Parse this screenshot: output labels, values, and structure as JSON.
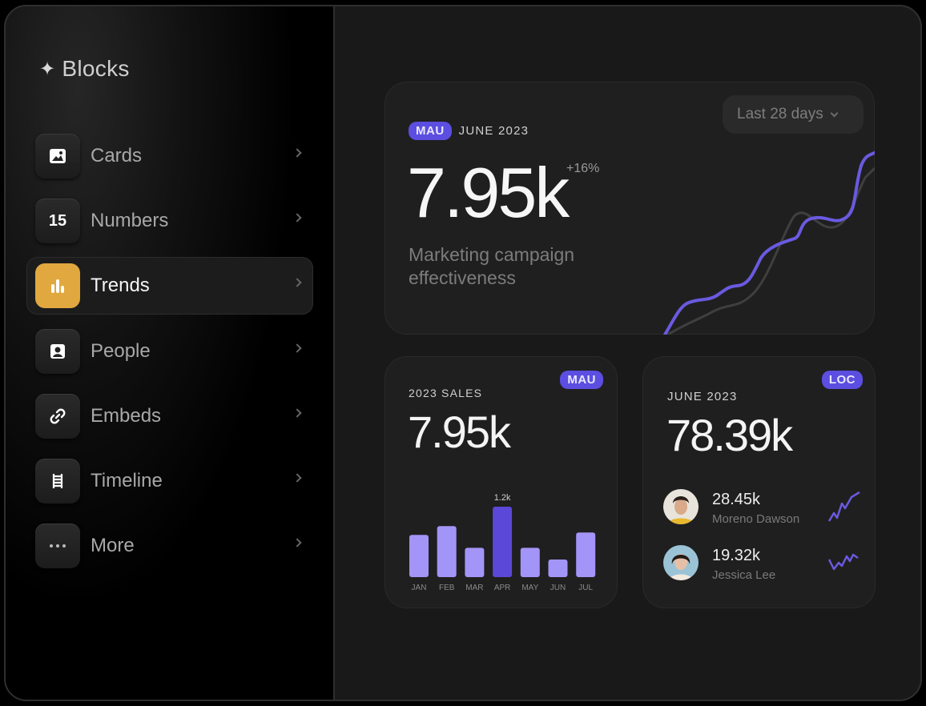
{
  "app": {
    "logo_text": "Blocks",
    "logo_icon": "sparkle-icon"
  },
  "sidebar": {
    "items": [
      {
        "label": "Cards",
        "icon": "image-icon",
        "active": false
      },
      {
        "label": "Numbers",
        "icon": "number-15-icon",
        "icon_text": "15",
        "active": false
      },
      {
        "label": "Trends",
        "icon": "bar-chart-icon",
        "active": true
      },
      {
        "label": "People",
        "icon": "person-badge-icon",
        "active": false
      },
      {
        "label": "Embeds",
        "icon": "link-icon",
        "active": false
      },
      {
        "label": "Timeline",
        "icon": "ladder-icon",
        "active": false
      },
      {
        "label": "More",
        "icon": "more-dots-icon",
        "active": false
      }
    ]
  },
  "main_card": {
    "badge": "MAU",
    "period": "JUNE 2023",
    "range_button": "Last 28 days",
    "value": "7.95k",
    "delta": "+16%",
    "description": "Marketing campaign effectiveness",
    "accent_color": "#6a5ae0"
  },
  "sales_card": {
    "kicker": "2023 SALES",
    "badge": "MAU",
    "value": "7.95k",
    "highlight_label": "1.2k",
    "chart_data": {
      "type": "bar",
      "categories": [
        "JAN",
        "FEB",
        "MAR",
        "APR",
        "MAY",
        "JUN",
        "JUL"
      ],
      "values": [
        0.72,
        0.87,
        0.5,
        1.2,
        0.5,
        0.3,
        0.76
      ],
      "highlight_index": 3,
      "bar_color": "#a394f7",
      "highlight_color": "#5b48d8"
    }
  },
  "loc_card": {
    "kicker": "JUNE 2023",
    "badge": "LOC",
    "value": "78.39k",
    "people": [
      {
        "value": "28.45k",
        "name": "Moreno Dawson"
      },
      {
        "value": "19.32k",
        "name": "Jessica Lee"
      }
    ]
  }
}
